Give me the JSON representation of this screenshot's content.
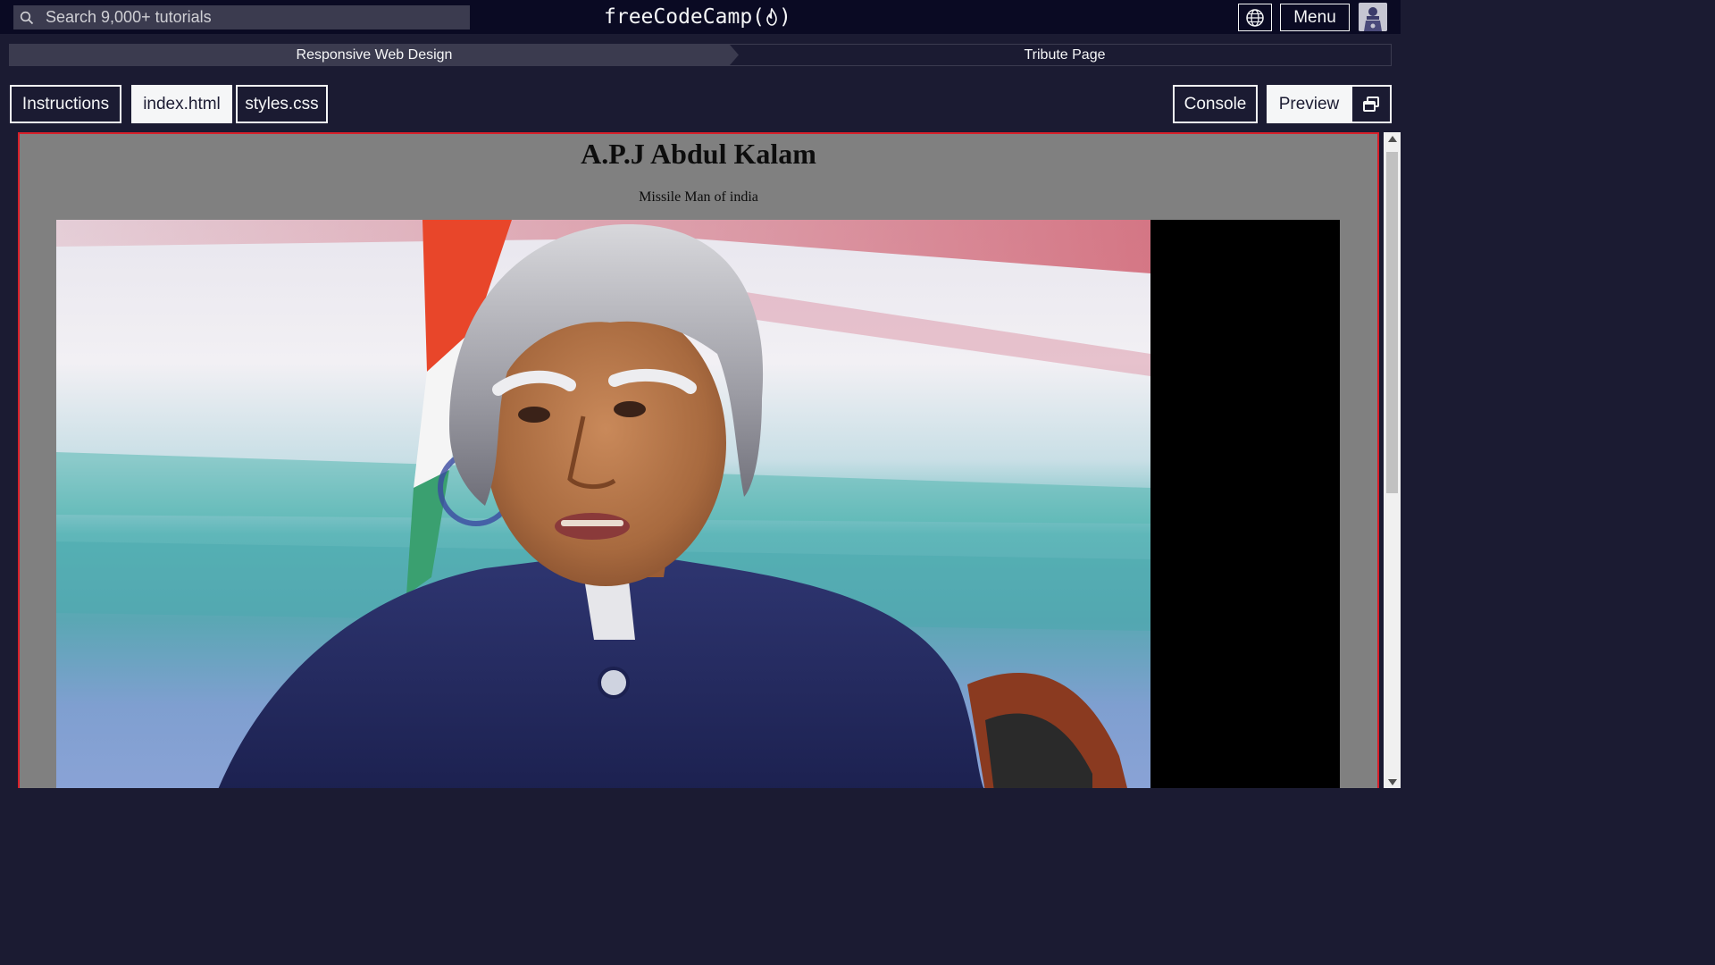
{
  "topnav": {
    "search_placeholder": "Search 9,000+ tutorials",
    "logo_text_left": "freeCodeCamp(",
    "logo_text_right": ")",
    "menu_label": "Menu",
    "icons": {
      "search": "search-icon",
      "language": "globe-icon",
      "logo": "flame-icon",
      "avatar": "user-avatar"
    }
  },
  "breadcrumb": {
    "items": [
      {
        "label": "Responsive Web Design"
      },
      {
        "label": "Tribute Page"
      }
    ]
  },
  "tabs": {
    "instructions": "Instructions",
    "index": "index.html",
    "styles": "styles.css",
    "console": "Console",
    "preview": "Preview"
  },
  "preview": {
    "title": "A.P.J Abdul Kalam",
    "subtitle": "Missile Man of india",
    "image": "portrait-photo"
  },
  "colors": {
    "nav_bg": "#0a0a23",
    "page_bg": "#1b1b32",
    "preview_bg": "#808080",
    "frame_border": "#d8202a",
    "light_text": "#f5f6f7"
  }
}
